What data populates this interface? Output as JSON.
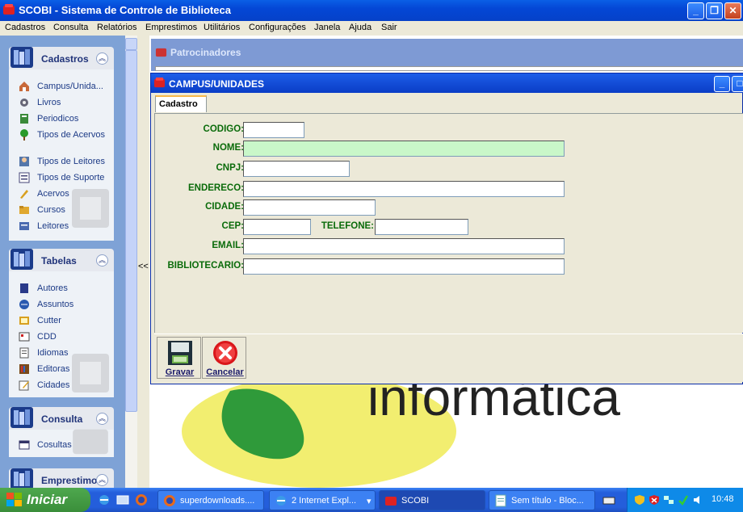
{
  "window": {
    "title": "SCOBI - Sistema de Controle de Biblioteca"
  },
  "menu": [
    "Cadastros",
    "Consulta",
    "Relatórios",
    "Emprestimos",
    "Utilitários",
    "Configurações",
    "Janela",
    "Ajuda",
    "Sair"
  ],
  "sidebar": {
    "cadastros": {
      "title": "Cadastros",
      "items": [
        "Campus/Unida...",
        "Livros",
        "Periodicos",
        "Tipos de Acervos",
        "Tipos de Leitores",
        "Tipos de Suporte",
        "Acervos",
        "Cursos",
        "Leitores"
      ]
    },
    "tabelas": {
      "title": "Tabelas",
      "items": [
        "Autores",
        "Assuntos",
        "Cutter",
        "CDD",
        "Idiomas",
        "Editoras",
        "Cidades"
      ]
    },
    "consulta": {
      "title": "Consulta",
      "items": [
        "Cosultas"
      ]
    },
    "emprestimo": {
      "title": "Emprestimo"
    }
  },
  "splitter": "<<",
  "patrocinadores": {
    "title": "Patrocinadores"
  },
  "campus_form": {
    "title": "CAMPUS/UNIDADES",
    "tab": "Cadastro",
    "labels": {
      "codigo": "CODIGO:",
      "nome": "NOME:",
      "cnpj": "CNPJ:",
      "endereco": "ENDERECO:",
      "cidade": "CIDADE:",
      "cep": "CEP:",
      "telefone": "TELEFONE:",
      "email": "EMAIL:",
      "bibliotecario": "BIBLIOTECARIO:"
    },
    "values": {
      "codigo": "",
      "nome": "",
      "cnpj": "",
      "endereco": "",
      "cidade": "",
      "cep": "",
      "telefone": "",
      "email": "",
      "bibliotecario": ""
    },
    "buttons": {
      "gravar": "Gravar",
      "cancelar": "Cancelar"
    }
  },
  "background_logo_text": "informática",
  "taskbar": {
    "start": "Iniciar",
    "buttons": [
      "superdownloads....",
      "2 Internet Expl...",
      "SCOBI",
      "Sem título - Bloc..."
    ],
    "clock": "10:48"
  }
}
